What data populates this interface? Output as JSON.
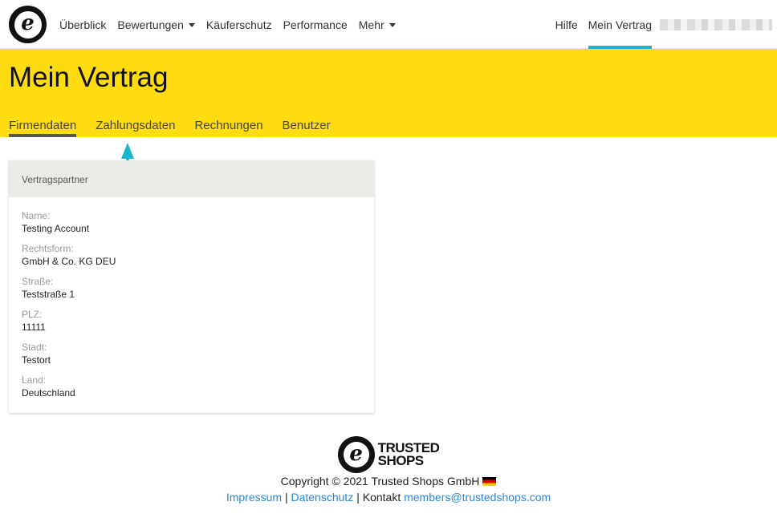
{
  "topnav": {
    "logo_letter": "e",
    "items": [
      {
        "label": "Überblick",
        "dropdown": false
      },
      {
        "label": "Bewertungen",
        "dropdown": true
      },
      {
        "label": "Käuferschutz",
        "dropdown": false
      },
      {
        "label": "Performance",
        "dropdown": false
      },
      {
        "label": "Mehr",
        "dropdown": true
      }
    ],
    "help": "Hilfe",
    "contract": "Mein Vertrag"
  },
  "header": {
    "title": "Mein Vertrag",
    "tabs": [
      {
        "label": "Firmendaten",
        "active": true
      },
      {
        "label": "Zahlungsdaten",
        "active": false
      },
      {
        "label": "Rechnungen",
        "active": false
      },
      {
        "label": "Benutzer",
        "active": false
      }
    ]
  },
  "card": {
    "title": "Vertragspartner",
    "fields": [
      {
        "label": "Name:",
        "value": "Testing Account"
      },
      {
        "label": "Rechtsform:",
        "value": "GmbH & Co. KG DEU"
      },
      {
        "label": "Straße:",
        "value": "Teststraße 1"
      },
      {
        "label": "PLZ:",
        "value": "11111"
      },
      {
        "label": "Stadt:",
        "value": "Testort"
      },
      {
        "label": "Land:",
        "value": "Deutschland"
      }
    ]
  },
  "footer": {
    "logo_line1": "TRUSTED",
    "logo_line2": "SHOPS",
    "copyright": "Copyright © 2021 Trusted Shops GmbH",
    "impressum": "Impressum",
    "sep": "|",
    "datenschutz": "Datenschutz",
    "kontakt": "Kontakt",
    "email": "members@trustedshops.com"
  },
  "colors": {
    "brand_yellow": "#ffdc0f",
    "accent_cyan": "#18b6cc",
    "link_blue": "#2a86d6"
  }
}
